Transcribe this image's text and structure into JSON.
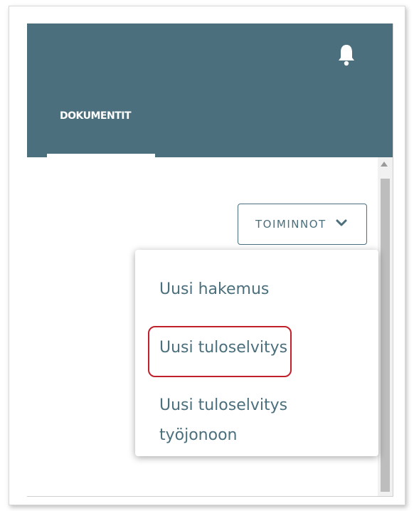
{
  "header": {
    "tab_label": "DOKUMENTIT",
    "bell_icon": "bell-icon",
    "background_color": "#4b6f7c"
  },
  "actions": {
    "button_label": "TOIMINNOT",
    "button_icon": "chevron-down-icon"
  },
  "menu": {
    "items": [
      {
        "label": "Uusi hakemus"
      },
      {
        "label": "Uusi tuloselvitys",
        "highlighted": true
      },
      {
        "label": "Uusi tuloselvitys työjonoon"
      }
    ],
    "highlight_color": "#c0202b"
  }
}
